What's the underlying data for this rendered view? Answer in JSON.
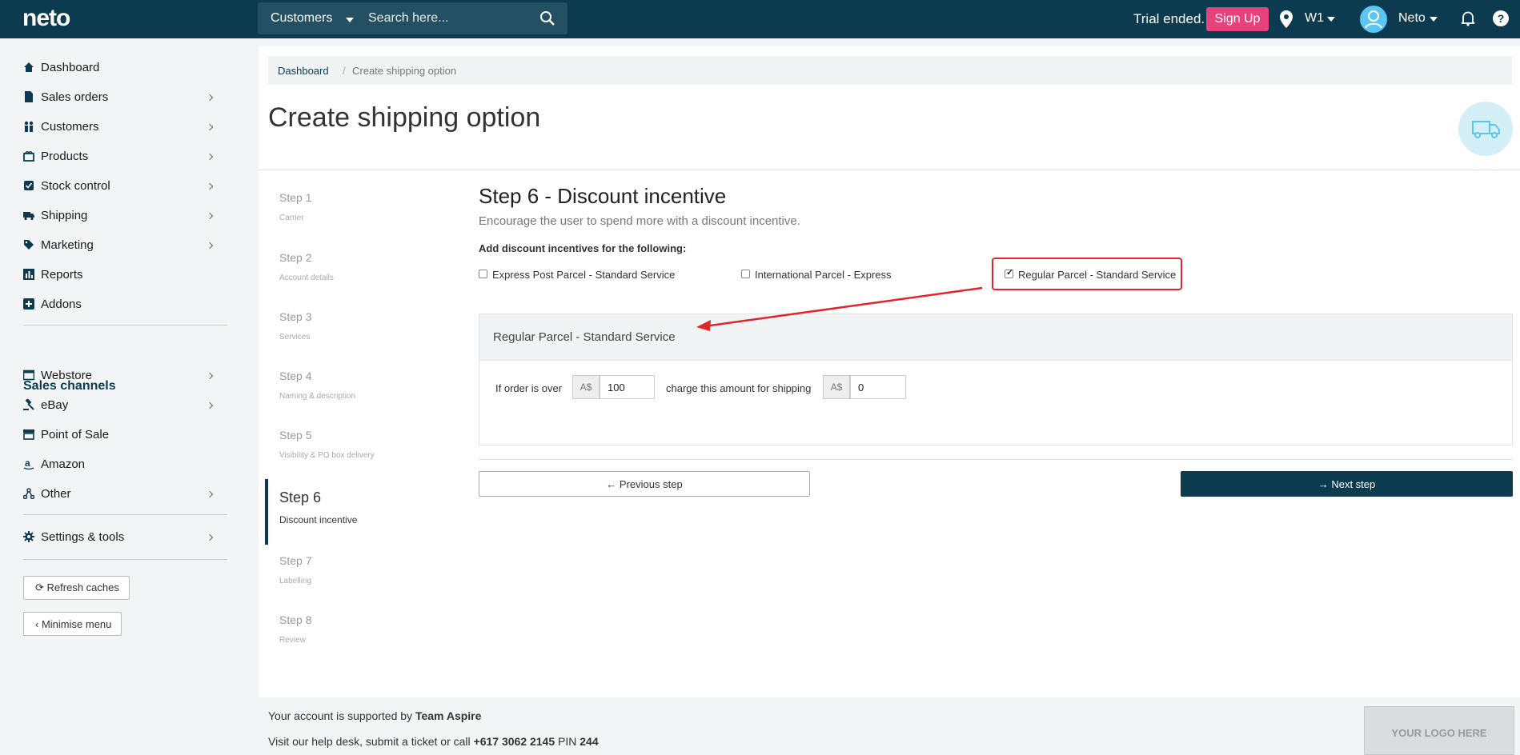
{
  "topbar": {
    "logo": "neto",
    "search_scope": "Customers",
    "search_placeholder": "Search here...",
    "trial_text": "Trial ended.",
    "signup_label": "Sign Up",
    "location": "W1",
    "user_name": "Neto",
    "help": "?"
  },
  "sidebar": {
    "items": [
      {
        "label": "Dashboard",
        "icon": "home-icon"
      },
      {
        "label": "Sales orders",
        "icon": "document-icon"
      },
      {
        "label": "Customers",
        "icon": "people-icon"
      },
      {
        "label": "Products",
        "icon": "box-icon"
      },
      {
        "label": "Stock control",
        "icon": "checkbox-icon"
      },
      {
        "label": "Shipping",
        "icon": "truck-icon"
      },
      {
        "label": "Marketing",
        "icon": "tag-icon"
      },
      {
        "label": "Reports",
        "icon": "chart-icon"
      },
      {
        "label": "Addons",
        "icon": "plus-icon"
      }
    ],
    "channels_title": "Sales channels",
    "channels": [
      {
        "label": "Webstore",
        "icon": "window-icon"
      },
      {
        "label": "eBay",
        "icon": "gavel-icon"
      },
      {
        "label": "Point of Sale",
        "icon": "store-icon"
      },
      {
        "label": "Amazon",
        "icon": "amazon-icon"
      },
      {
        "label": "Other",
        "icon": "share-icon"
      }
    ],
    "settings_label": "Settings & tools",
    "refresh_label": "Refresh caches",
    "minimise_label": "Minimise menu"
  },
  "breadcrumb": {
    "home": "Dashboard",
    "separator": "/",
    "current": "Create shipping option"
  },
  "page_title": "Create shipping option",
  "steps": [
    {
      "name": "Step 1",
      "desc": "Carrier"
    },
    {
      "name": "Step 2",
      "desc": "Account details"
    },
    {
      "name": "Step 3",
      "desc": "Services"
    },
    {
      "name": "Step 4",
      "desc": "Naming & description"
    },
    {
      "name": "Step 5",
      "desc": "Visibility & PO box delivery"
    },
    {
      "name": "Step 6",
      "desc": "Discount incentive"
    },
    {
      "name": "Step 7",
      "desc": "Labelling"
    },
    {
      "name": "Step 8",
      "desc": "Review"
    }
  ],
  "active_step": 6,
  "main": {
    "heading": "Step 6 - Discount incentive",
    "subheading": "Encourage the user to spend more with a discount incentive.",
    "add_label": "Add discount incentives for the following:",
    "services": [
      {
        "label": "Express Post Parcel - Standard Service",
        "checked": false
      },
      {
        "label": "International Parcel - Express",
        "checked": false
      },
      {
        "label": "Regular Parcel - Standard Service",
        "checked": true
      }
    ],
    "panel_title": "Regular Parcel - Standard Service",
    "order_over_label": "If order is over",
    "currency": "A$",
    "threshold_value": "100",
    "charge_label": "charge this amount for shipping",
    "charge_value": "0",
    "prev_label": "Previous step",
    "next_label": "Next step"
  },
  "footer": {
    "support_prefix": "Your account is supported by",
    "team": "Team Aspire",
    "help_prefix": "Visit our help desk, submit a ticket or call",
    "phone": "+617 3062 2145",
    "pin_label": "PIN",
    "pin": "244",
    "logo_placeholder": "YOUR LOGO HERE"
  },
  "colors": {
    "brand": "#0c3b4f",
    "signup": "#e8427c",
    "annotation": "#e0262b",
    "avatar": "#5bc7f0"
  }
}
